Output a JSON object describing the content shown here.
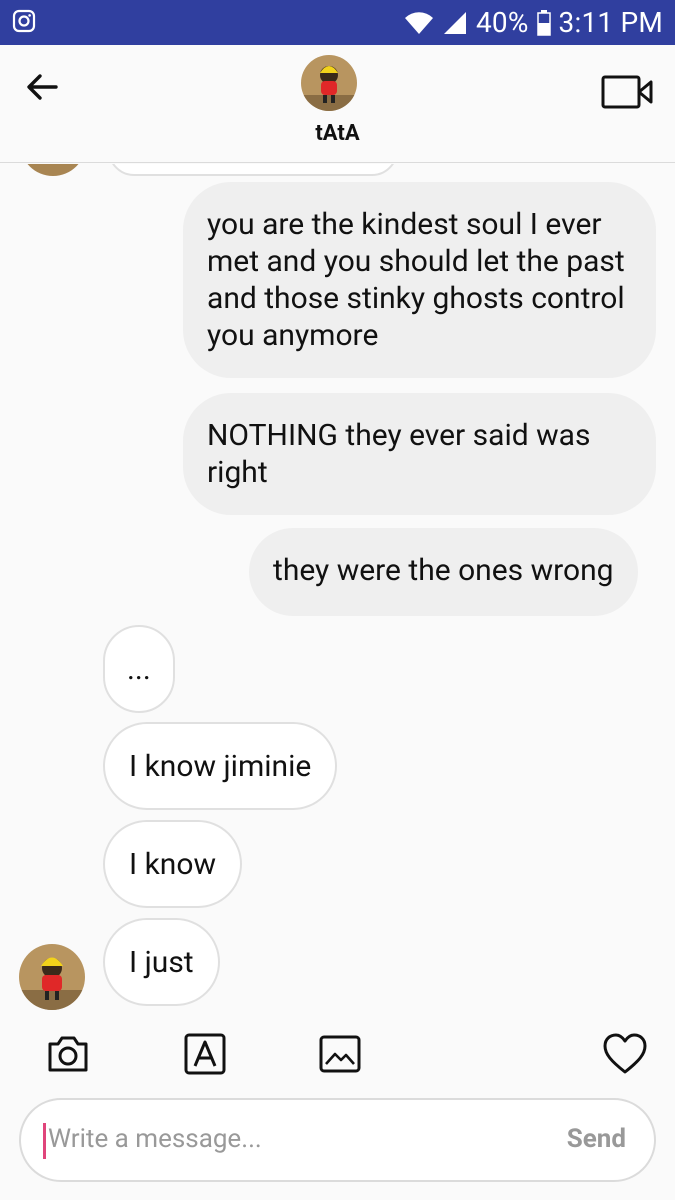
{
  "status_bar": {
    "battery": "40%",
    "time": "3:11 PM"
  },
  "header": {
    "contact_name": "tAtA"
  },
  "messages": [
    {
      "side": "sent",
      "text": "you are the kindest soul I ever met and you should let the past and those stinky ghosts control you anymore"
    },
    {
      "side": "sent",
      "text": "NOTHING they ever said was right"
    },
    {
      "side": "sent",
      "text": "they were the ones wrong"
    },
    {
      "side": "received",
      "text": "..."
    },
    {
      "side": "received",
      "text": "I know jiminie"
    },
    {
      "side": "received",
      "text": "I know"
    },
    {
      "side": "received",
      "text": "I just"
    }
  ],
  "composer": {
    "placeholder": "Write a message...",
    "send_label": "Send"
  },
  "colors": {
    "status_bar": "#303f9f",
    "caret": "#e0457b",
    "sent_bubble": "#efefef",
    "received_border": "#e0e0e0"
  }
}
